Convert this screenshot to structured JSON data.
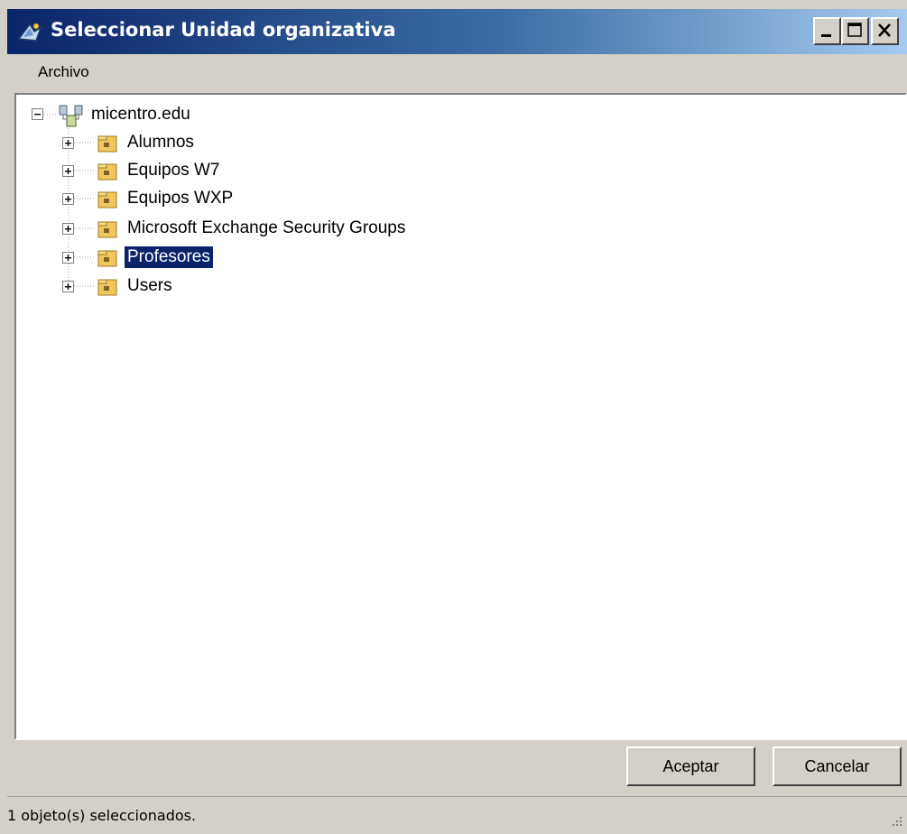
{
  "window": {
    "title": "Seleccionar Unidad organizativa",
    "icon": "directory-app-icon",
    "controls": [
      "minimize",
      "maximize",
      "close"
    ]
  },
  "menu": {
    "items": [
      {
        "label": "Archivo"
      }
    ]
  },
  "tree": {
    "root": {
      "label": "micentro.edu",
      "icon": "domain-icon",
      "expanded": true
    },
    "children": [
      {
        "label": "Alumnos",
        "icon": "ou-folder-icon",
        "selected": false
      },
      {
        "label": "Equipos W7",
        "icon": "ou-folder-icon",
        "selected": false
      },
      {
        "label": "Equipos WXP",
        "icon": "ou-folder-icon",
        "selected": false
      },
      {
        "label": "Microsoft Exchange Security Groups",
        "icon": "ou-folder-icon",
        "selected": false
      },
      {
        "label": "Profesores",
        "icon": "ou-folder-icon",
        "selected": true
      },
      {
        "label": "Users",
        "icon": "ou-folder-icon",
        "selected": false
      }
    ]
  },
  "buttons": {
    "accept": "Aceptar",
    "cancel": "Cancelar"
  },
  "status": {
    "text": "1 objeto(s) seleccionados."
  },
  "colors": {
    "titlebar_start": "#0a246a",
    "titlebar_end": "#a6caf0",
    "selection": "#0a246a",
    "face": "#d4d0c8",
    "folder": "#f0c75c"
  }
}
